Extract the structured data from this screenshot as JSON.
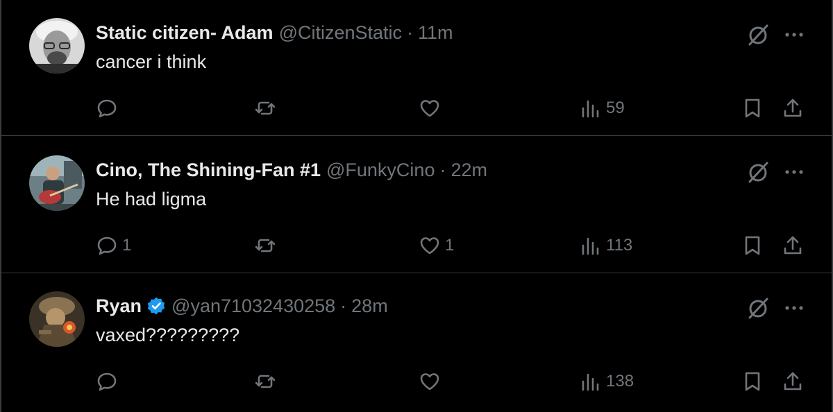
{
  "replies": [
    {
      "display_name": "Static citizen- Adam",
      "handle": "@CitizenStatic",
      "separator": "·",
      "time": "11m",
      "verified": false,
      "text": "cancer i think",
      "reply_count": "",
      "like_count": "",
      "views": "59"
    },
    {
      "display_name": "Cino, The Shining-Fan #1",
      "handle": "@FunkyCino",
      "separator": "·",
      "time": "22m",
      "verified": false,
      "text": "He had ligma",
      "reply_count": "1",
      "like_count": "1",
      "views": "113"
    },
    {
      "display_name": "Ryan",
      "handle": "@yan71032430258",
      "separator": "·",
      "time": "28m",
      "verified": true,
      "text": "vaxed?????????",
      "reply_count": "",
      "like_count": "",
      "views": "138"
    }
  ],
  "icons": {
    "reply": "speech-bubble-icon",
    "repost": "repost-arrows-icon",
    "like": "heart-icon",
    "views": "bar-chart-icon",
    "bookmark": "bookmark-icon",
    "share": "share-upload-icon",
    "grok": "grok-slash-circle-icon",
    "more": "more-dots-icon",
    "verified": "verified-badge-icon"
  },
  "colors": {
    "background": "#000000",
    "primary_text": "#e7e9ea",
    "secondary_text": "#71767b",
    "divider": "#3a3d41",
    "verified_blue": "#1d9bf0"
  }
}
